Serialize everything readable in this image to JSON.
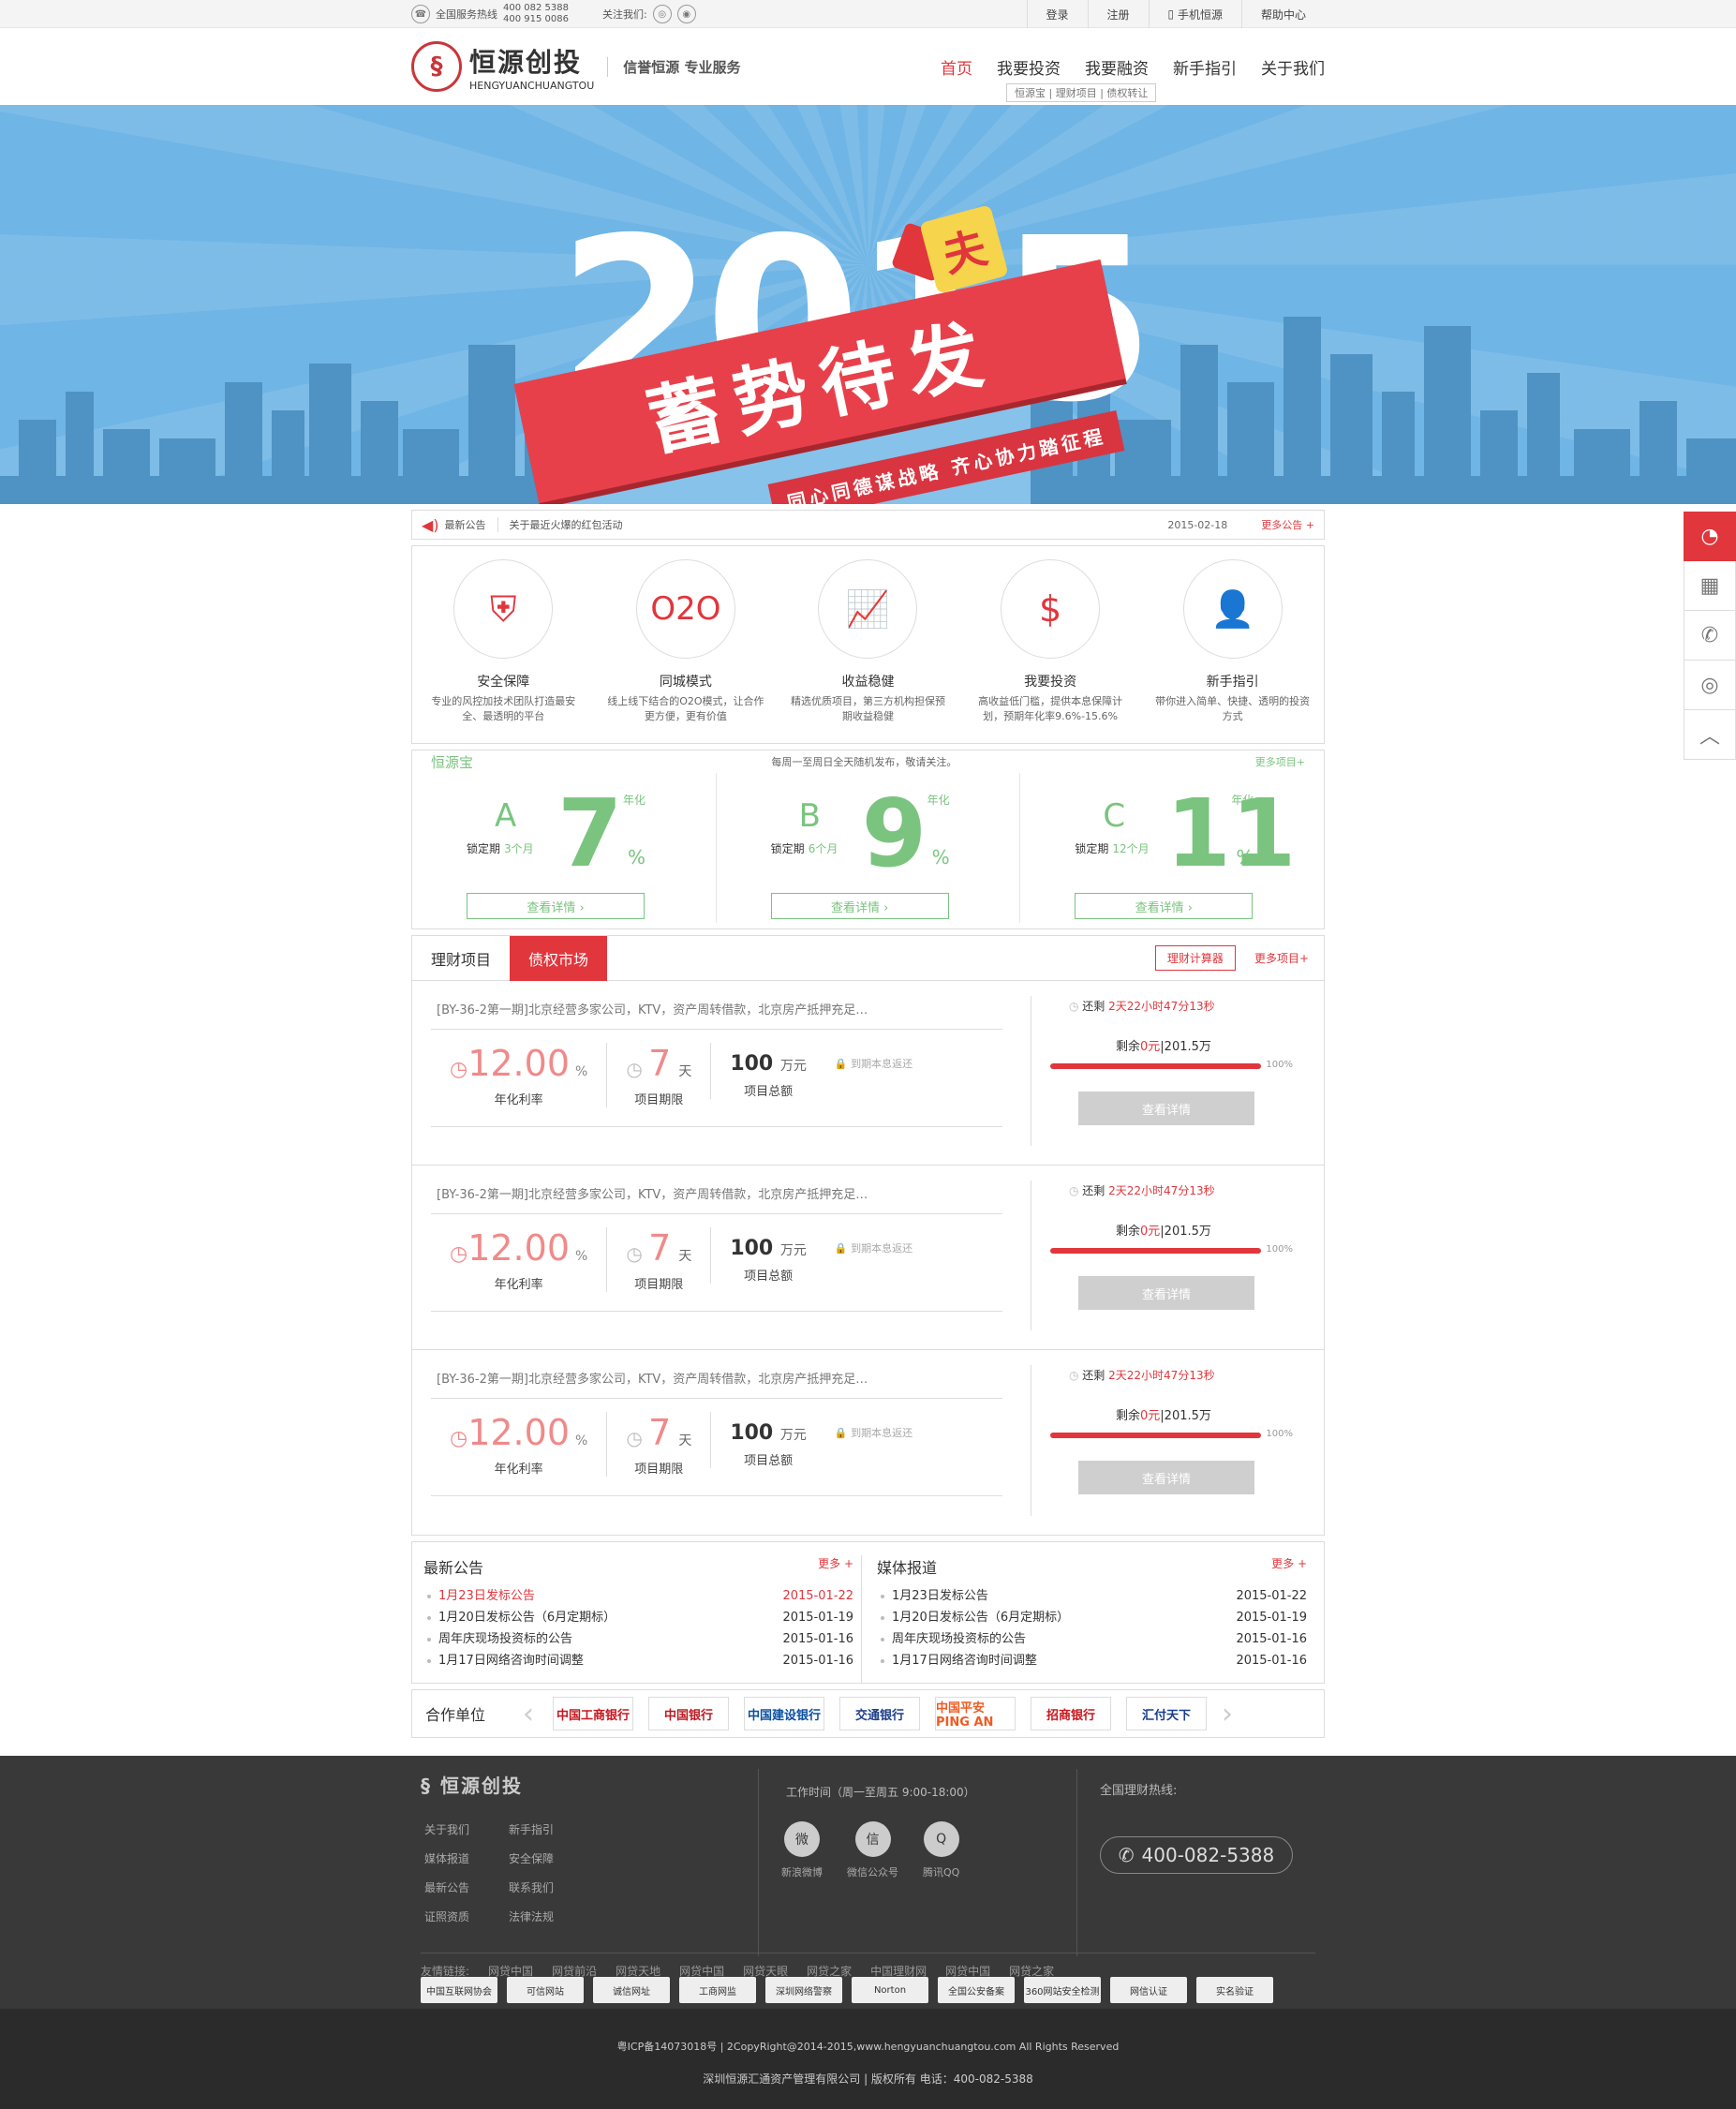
{
  "topbar": {
    "hotline_label": "全国服务热线",
    "hotline_1": "400 082 5388",
    "hotline_2": "400 915 0086",
    "follow_label": "关注我们:",
    "links": [
      "登录",
      "注册",
      "手机恒源",
      "帮助中心"
    ]
  },
  "header": {
    "logo_cn": "恒源创投",
    "logo_en": "HENGYUANCHUANGTOU",
    "slogan": "信誉恒源  专业服务",
    "nav": [
      "首页",
      "我要投资",
      "我要融资",
      "新手指引",
      "关于我们"
    ],
    "subnav": "恒源宝 | 理财项目 | 债权转让"
  },
  "banner": {
    "year": "2015",
    "main": "蓄势待发",
    "sub": "同心同德谋战略  齐心协力踏征程",
    "tag": "夫"
  },
  "notice": {
    "label": "最新公告",
    "text": "关于最近火爆的红包活动",
    "date": "2015-02-18",
    "more": "更多公告 +"
  },
  "features": [
    {
      "icon": "shield-icon",
      "glyph": "⛨",
      "title": "安全保障",
      "desc": "专业的风控加技术团队打造最安全、最透明的平台"
    },
    {
      "icon": "o2o-icon",
      "glyph": "O2O",
      "title": "同城模式",
      "desc": "线上线下结合的O2O模式，让合作更方便，更有价值"
    },
    {
      "icon": "chart-icon",
      "glyph": "📈",
      "title": "收益稳健",
      "desc": "精选优质项目，第三方机构担保预期收益稳健"
    },
    {
      "icon": "money-bag-icon",
      "glyph": "$",
      "title": "我要投资",
      "desc": "高收益低门槛，提供本息保障计划，预期年化率9.6%-15.6%"
    },
    {
      "icon": "person-icon",
      "glyph": "👤",
      "title": "新手指引",
      "desc": "带你进入简单、快捷、透明的投资方式"
    }
  ],
  "hyb": {
    "title": "恒源宝",
    "mid": "每周一至周日全天随机发布，敬请关注。",
    "more": "更多项目+",
    "items": [
      {
        "letter": "A",
        "lock_label": "锁定期",
        "lock": "3个月",
        "num": "7",
        "nh": "年化",
        "pc": "%",
        "btn": "查看详情 ›"
      },
      {
        "letter": "B",
        "lock_label": "锁定期",
        "lock": "6个月",
        "num": "9",
        "nh": "年化",
        "pc": "%",
        "btn": "查看详情 ›"
      },
      {
        "letter": "C",
        "lock_label": "锁定期",
        "lock": "12个月",
        "num": "11",
        "nh": "年化",
        "pc": "%",
        "btn": "查看详情 ›"
      }
    ]
  },
  "projects": {
    "tabs": [
      "理财项目",
      "债权市场"
    ],
    "calc": "理财计算器",
    "more": "更多项目+",
    "rows": [
      {
        "title": "[BY-36-2第一期]北京经营多家公司，KTV，资产周转借款，北京房产抵押充足…",
        "rate": "12.00",
        "rate_unit": "%",
        "rate_label": "年化利率",
        "days": "7",
        "days_unit": "天",
        "days_label": "项目期限",
        "total": "100",
        "total_unit": "万元",
        "total_label": "项目总额",
        "info": "到期本息返还",
        "time_label": "还剩",
        "time": "2天22小时47分13秒",
        "remain_a": "剩余",
        "remain_v": "0元",
        "remain_b": "|201.5万",
        "pct": "100%",
        "btn": "查看详情"
      },
      {
        "title": "[BY-36-2第一期]北京经营多家公司，KTV，资产周转借款，北京房产抵押充足…",
        "rate": "12.00",
        "rate_unit": "%",
        "rate_label": "年化利率",
        "days": "7",
        "days_unit": "天",
        "days_label": "项目期限",
        "total": "100",
        "total_unit": "万元",
        "total_label": "项目总额",
        "info": "到期本息返还",
        "time_label": "还剩",
        "time": "2天22小时47分13秒",
        "remain_a": "剩余",
        "remain_v": "0元",
        "remain_b": "|201.5万",
        "pct": "100%",
        "btn": "查看详情"
      },
      {
        "title": "[BY-36-2第一期]北京经营多家公司，KTV，资产周转借款，北京房产抵押充足…",
        "rate": "12.00",
        "rate_unit": "%",
        "rate_label": "年化利率",
        "days": "7",
        "days_unit": "天",
        "days_label": "项目期限",
        "total": "100",
        "total_unit": "万元",
        "total_label": "项目总额",
        "info": "到期本息返还",
        "time_label": "还剩",
        "time": "2天22小时47分13秒",
        "remain_a": "剩余",
        "remain_v": "0元",
        "remain_b": "|201.5万",
        "pct": "100%",
        "btn": "查看详情"
      }
    ]
  },
  "news": {
    "left": {
      "title": "最新公告",
      "more": "更多 +",
      "items": [
        {
          "t": "1月23日发标公告",
          "d": "2015-01-22",
          "hot": true
        },
        {
          "t": "1月20日发标公告（6月定期标）",
          "d": "2015-01-19",
          "hot": false
        },
        {
          "t": "周年庆现场投资标的公告",
          "d": "2015-01-16",
          "hot": false
        },
        {
          "t": "1月17日网络咨询时间调整",
          "d": "2015-01-16",
          "hot": false
        }
      ]
    },
    "right": {
      "title": "媒体报道",
      "more": "更多 +",
      "items": [
        {
          "t": "1月23日发标公告",
          "d": "2015-01-22",
          "hot": false
        },
        {
          "t": "1月20日发标公告（6月定期标）",
          "d": "2015-01-19",
          "hot": false
        },
        {
          "t": "周年庆现场投资标的公告",
          "d": "2015-01-16",
          "hot": false
        },
        {
          "t": "1月17日网络咨询时间调整",
          "d": "2015-01-16",
          "hot": false
        }
      ]
    }
  },
  "partners": {
    "label": "合作单位",
    "logos": [
      {
        "name": "中国工商银行",
        "color": "#c8161d"
      },
      {
        "name": "中国银行",
        "color": "#b81c22"
      },
      {
        "name": "中国建设银行",
        "color": "#0b4ea2"
      },
      {
        "name": "交通银行",
        "color": "#1d3f8a"
      },
      {
        "name": "中国平安 PING AN",
        "color": "#f05a22"
      },
      {
        "name": "招商银行",
        "color": "#c8161d"
      },
      {
        "name": "汇付天下",
        "color": "#1a3d8f"
      }
    ]
  },
  "footer": {
    "logo": "恒源创投",
    "links": [
      "关于我们",
      "新手指引",
      "媒体报道",
      "安全保障",
      "最新公告",
      "联系我们",
      "证照资质",
      "法律法规"
    ],
    "work": "工作时间（周一至周五 9:00-18:00）",
    "social": [
      {
        "icon": "weibo-icon",
        "glyph": "微",
        "label": "新浪微博"
      },
      {
        "icon": "wechat-icon",
        "glyph": "信",
        "label": "微信公众号"
      },
      {
        "icon": "qq-icon",
        "glyph": "Q",
        "label": "腾讯QQ"
      }
    ],
    "hot_label": "全国理财热线:",
    "tel": "400-082-5388",
    "friend_label": "友情链接:",
    "friends": [
      "网贷中国",
      "网贷前沿",
      "网贷天地",
      "网贷中国",
      "网贷天眼",
      "网贷之家",
      "中国理财网",
      "网贷中国",
      "网贷之家"
    ],
    "certs": [
      "中国互联网协会",
      "可信网站",
      "诚信网址",
      "工商网监",
      "深圳网络警察",
      "Norton",
      "全国公安备案",
      "360网站安全检测",
      "网信认证",
      "实名验证"
    ]
  },
  "bottom": {
    "line1": "粤ICP备14073018号  |  2CopyRight@2014-2015,www.hengyuanchuangtou.com All Rights Reserved",
    "line2": "深圳恒源汇通资产管理有限公司  |  版权所有    电话：400-082-5388"
  },
  "side": [
    "qq-icon",
    "calculator-icon",
    "phone-icon",
    "wechat-icon",
    "back-to-top-icon"
  ],
  "colors": {
    "accent": "#e0363c",
    "green": "#7ac47f",
    "banner": "#6fb5e6"
  }
}
